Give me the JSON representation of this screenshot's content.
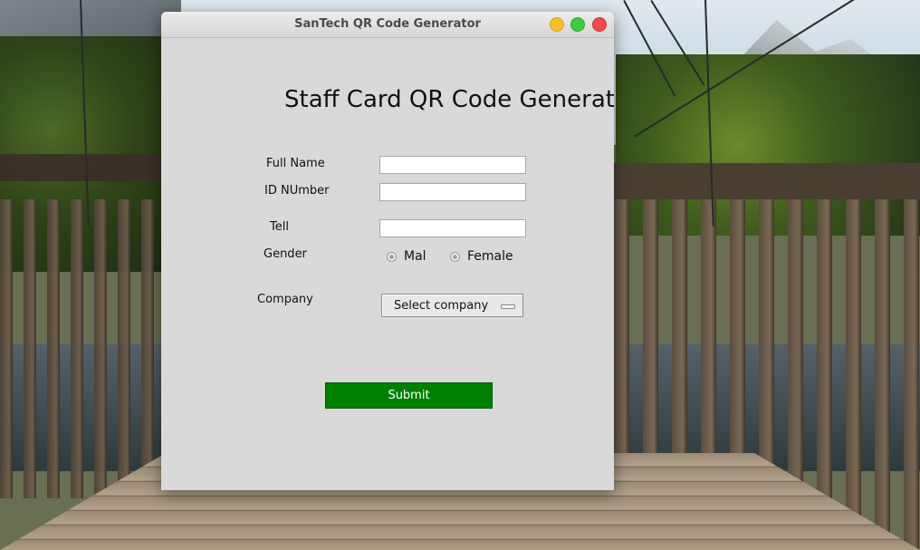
{
  "window": {
    "title": "SanTech QR Code Generator",
    "controls": [
      "minimize-icon",
      "maximize-icon",
      "close-icon"
    ]
  },
  "form": {
    "heading": "Staff Card QR Code Generator",
    "fields": {
      "full_name": {
        "label": "Full Name",
        "value": ""
      },
      "id_number": {
        "label": "ID NUmber",
        "value": ""
      },
      "tell": {
        "label": "Tell",
        "value": ""
      }
    },
    "gender": {
      "label": "Gender",
      "options": [
        "Mal",
        "Female"
      ]
    },
    "company": {
      "label": "Company",
      "selected": "Select company"
    },
    "submit_label": "Submit"
  },
  "colors": {
    "window_bg": "#d9d9d9",
    "submit_bg": "#008000",
    "submit_text": "#ffffff",
    "close_button": "#ef4b4b",
    "maximize_button": "#3ecb3e",
    "minimize_button": "#f5bf2c"
  }
}
